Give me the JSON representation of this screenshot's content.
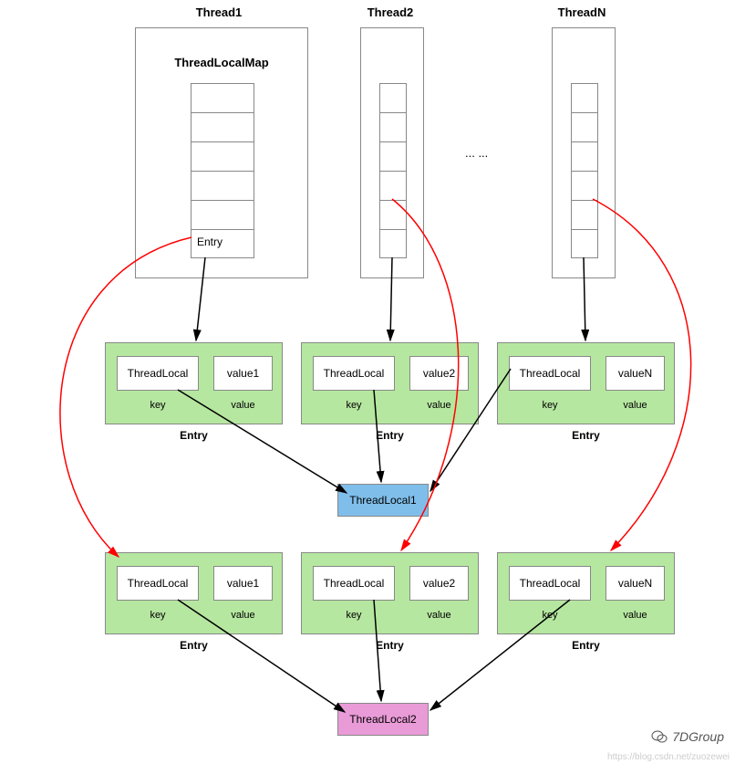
{
  "threads": {
    "t1": "Thread1",
    "t2": "Thread2",
    "tn": "ThreadN"
  },
  "map_label": "ThreadLocalMap",
  "entry_cell": "Entry",
  "ellipsis": "... ...",
  "entries_row1": [
    {
      "key_label": "ThreadLocal",
      "value_label": "value1",
      "key_sub": "key",
      "value_sub": "value",
      "title": "Entry"
    },
    {
      "key_label": "ThreadLocal",
      "value_label": "value2",
      "key_sub": "key",
      "value_sub": "value",
      "title": "Entry"
    },
    {
      "key_label": "ThreadLocal",
      "value_label": "valueN",
      "key_sub": "key",
      "value_sub": "value",
      "title": "Entry"
    }
  ],
  "entries_row2": [
    {
      "key_label": "ThreadLocal",
      "value_label": "value1",
      "key_sub": "key",
      "value_sub": "value",
      "title": "Entry"
    },
    {
      "key_label": "ThreadLocal",
      "value_label": "value2",
      "key_sub": "key",
      "value_sub": "value",
      "title": "Entry"
    },
    {
      "key_label": "ThreadLocal",
      "value_label": "valueN",
      "key_sub": "key",
      "value_sub": "value",
      "title": "Entry"
    }
  ],
  "threadlocal1": "ThreadLocal1",
  "threadlocal2": "ThreadLocal2",
  "signature": "7DGroup",
  "watermark": "https://blog.csdn.net/zuozewei"
}
